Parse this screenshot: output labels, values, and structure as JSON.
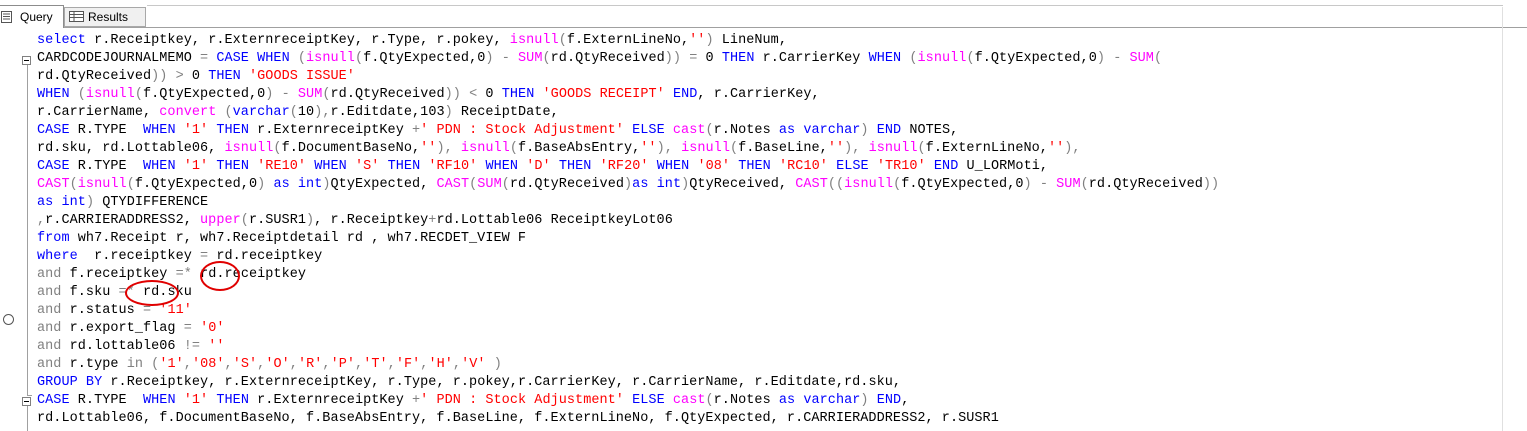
{
  "tabs": [
    {
      "label": "Query",
      "icon": "query-document-icon",
      "active": true
    },
    {
      "label": "Results",
      "icon": "results-grid-icon",
      "active": false
    }
  ],
  "code": [
    [
      [
        "k",
        "select"
      ],
      [
        "t",
        " r.Receiptkey, r.ExternreceiptKey, r.Type, r.pokey, "
      ],
      [
        "f",
        "isnull"
      ],
      [
        "g",
        "("
      ],
      [
        "t",
        "f.ExternLineNo,"
      ],
      [
        "s",
        "''"
      ],
      [
        "g",
        ")"
      ],
      [
        "t",
        " LineNum,"
      ]
    ],
    [
      [
        "t",
        "CARDCODEJOURNALMEMO "
      ],
      [
        "g",
        "="
      ],
      [
        "t",
        " "
      ],
      [
        "k",
        "CASE"
      ],
      [
        "t",
        " "
      ],
      [
        "k",
        "WHEN"
      ],
      [
        "t",
        " "
      ],
      [
        "g",
        "("
      ],
      [
        "f",
        "isnull"
      ],
      [
        "g",
        "("
      ],
      [
        "t",
        "f.QtyExpected,0"
      ],
      [
        "g",
        ")"
      ],
      [
        "t",
        " "
      ],
      [
        "g",
        "-"
      ],
      [
        "t",
        " "
      ],
      [
        "f",
        "SUM"
      ],
      [
        "g",
        "("
      ],
      [
        "t",
        "rd.QtyReceived"
      ],
      [
        "g",
        "))"
      ],
      [
        "t",
        " "
      ],
      [
        "g",
        "="
      ],
      [
        "t",
        " 0 "
      ],
      [
        "k",
        "THEN"
      ],
      [
        "t",
        " r.CarrierKey "
      ],
      [
        "k",
        "WHEN"
      ],
      [
        "t",
        " "
      ],
      [
        "g",
        "("
      ],
      [
        "f",
        "isnull"
      ],
      [
        "g",
        "("
      ],
      [
        "t",
        "f.QtyExpected,0"
      ],
      [
        "g",
        ")"
      ],
      [
        "t",
        " "
      ],
      [
        "g",
        "-"
      ],
      [
        "t",
        " "
      ],
      [
        "f",
        "SUM"
      ],
      [
        "g",
        "("
      ]
    ],
    [
      [
        "t",
        "rd.QtyReceived"
      ],
      [
        "g",
        "))"
      ],
      [
        "t",
        " "
      ],
      [
        "g",
        ">"
      ],
      [
        "t",
        " 0 "
      ],
      [
        "k",
        "THEN"
      ],
      [
        "t",
        " "
      ],
      [
        "s",
        "'GOODS ISSUE'"
      ]
    ],
    [
      [
        "k",
        "WHEN"
      ],
      [
        "t",
        " "
      ],
      [
        "g",
        "("
      ],
      [
        "f",
        "isnull"
      ],
      [
        "g",
        "("
      ],
      [
        "t",
        "f.QtyExpected,0"
      ],
      [
        "g",
        ")"
      ],
      [
        "t",
        " "
      ],
      [
        "g",
        "-"
      ],
      [
        "t",
        " "
      ],
      [
        "f",
        "SUM"
      ],
      [
        "g",
        "("
      ],
      [
        "t",
        "rd.QtyReceived"
      ],
      [
        "g",
        "))"
      ],
      [
        "t",
        " "
      ],
      [
        "g",
        "<"
      ],
      [
        "t",
        " 0 "
      ],
      [
        "k",
        "THEN"
      ],
      [
        "t",
        " "
      ],
      [
        "s",
        "'GOODS RECEIPT'"
      ],
      [
        "t",
        " "
      ],
      [
        "k",
        "END"
      ],
      [
        "t",
        ", r.CarrierKey,"
      ]
    ],
    [
      [
        "t",
        "r.CarrierName, "
      ],
      [
        "f",
        "convert"
      ],
      [
        "t",
        " "
      ],
      [
        "g",
        "("
      ],
      [
        "k",
        "varchar"
      ],
      [
        "g",
        "("
      ],
      [
        "t",
        "10"
      ],
      [
        "g",
        "),"
      ],
      [
        "t",
        "r.Editdate,103"
      ],
      [
        "g",
        ")"
      ],
      [
        "t",
        " ReceiptDate,"
      ]
    ],
    [
      [
        "k",
        "CASE"
      ],
      [
        "t",
        " R.TYPE  "
      ],
      [
        "k",
        "WHEN"
      ],
      [
        "t",
        " "
      ],
      [
        "s",
        "'1'"
      ],
      [
        "t",
        " "
      ],
      [
        "k",
        "THEN"
      ],
      [
        "t",
        " r.ExternreceiptKey "
      ],
      [
        "g",
        "+"
      ],
      [
        "s",
        "' PDN : Stock Adjustment'"
      ],
      [
        "t",
        " "
      ],
      [
        "k",
        "ELSE"
      ],
      [
        "t",
        " "
      ],
      [
        "f",
        "cast"
      ],
      [
        "g",
        "("
      ],
      [
        "t",
        "r.Notes "
      ],
      [
        "k",
        "as"
      ],
      [
        "t",
        " "
      ],
      [
        "k",
        "varchar"
      ],
      [
        "g",
        ")"
      ],
      [
        "t",
        " "
      ],
      [
        "k",
        "END"
      ],
      [
        "t",
        " NOTES,"
      ]
    ],
    [
      [
        "t",
        "rd.sku, rd.Lottable06, "
      ],
      [
        "f",
        "isnull"
      ],
      [
        "g",
        "("
      ],
      [
        "t",
        "f.DocumentBaseNo,"
      ],
      [
        "s",
        "''"
      ],
      [
        "g",
        "),"
      ],
      [
        "t",
        " "
      ],
      [
        "f",
        "isnull"
      ],
      [
        "g",
        "("
      ],
      [
        "t",
        "f.BaseAbsEntry,"
      ],
      [
        "s",
        "''"
      ],
      [
        "g",
        "),"
      ],
      [
        "t",
        " "
      ],
      [
        "f",
        "isnull"
      ],
      [
        "g",
        "("
      ],
      [
        "t",
        "f.BaseLine,"
      ],
      [
        "s",
        "''"
      ],
      [
        "g",
        "),"
      ],
      [
        "t",
        " "
      ],
      [
        "f",
        "isnull"
      ],
      [
        "g",
        "("
      ],
      [
        "t",
        "f.ExternLineNo,"
      ],
      [
        "s",
        "''"
      ],
      [
        "g",
        "),"
      ]
    ],
    [
      [
        "k",
        "CASE"
      ],
      [
        "t",
        " R.TYPE  "
      ],
      [
        "k",
        "WHEN"
      ],
      [
        "t",
        " "
      ],
      [
        "s",
        "'1'"
      ],
      [
        "t",
        " "
      ],
      [
        "k",
        "THEN"
      ],
      [
        "t",
        " "
      ],
      [
        "s",
        "'RE10'"
      ],
      [
        "t",
        " "
      ],
      [
        "k",
        "WHEN"
      ],
      [
        "t",
        " "
      ],
      [
        "s",
        "'S'"
      ],
      [
        "t",
        " "
      ],
      [
        "k",
        "THEN"
      ],
      [
        "t",
        " "
      ],
      [
        "s",
        "'RF10'"
      ],
      [
        "t",
        " "
      ],
      [
        "k",
        "WHEN"
      ],
      [
        "t",
        " "
      ],
      [
        "s",
        "'D'"
      ],
      [
        "t",
        " "
      ],
      [
        "k",
        "THEN"
      ],
      [
        "t",
        " "
      ],
      [
        "s",
        "'RF20'"
      ],
      [
        "t",
        " "
      ],
      [
        "k",
        "WHEN"
      ],
      [
        "t",
        " "
      ],
      [
        "s",
        "'08'"
      ],
      [
        "t",
        " "
      ],
      [
        "k",
        "THEN"
      ],
      [
        "t",
        " "
      ],
      [
        "s",
        "'RC10'"
      ],
      [
        "t",
        " "
      ],
      [
        "k",
        "ELSE"
      ],
      [
        "t",
        " "
      ],
      [
        "s",
        "'TR10'"
      ],
      [
        "t",
        " "
      ],
      [
        "k",
        "END"
      ],
      [
        "t",
        " U_LORMoti,"
      ]
    ],
    [
      [
        "f",
        "CAST"
      ],
      [
        "g",
        "("
      ],
      [
        "f",
        "isnull"
      ],
      [
        "g",
        "("
      ],
      [
        "t",
        "f.QtyExpected,0"
      ],
      [
        "g",
        ")"
      ],
      [
        "t",
        " "
      ],
      [
        "k",
        "as"
      ],
      [
        "t",
        " "
      ],
      [
        "k",
        "int"
      ],
      [
        "g",
        ")"
      ],
      [
        "t",
        "QtyExpected, "
      ],
      [
        "f",
        "CAST"
      ],
      [
        "g",
        "("
      ],
      [
        "f",
        "SUM"
      ],
      [
        "g",
        "("
      ],
      [
        "t",
        "rd.QtyReceived"
      ],
      [
        "g",
        ")"
      ],
      [
        "k",
        "as"
      ],
      [
        "t",
        " "
      ],
      [
        "k",
        "int"
      ],
      [
        "g",
        ")"
      ],
      [
        "t",
        "QtyReceived, "
      ],
      [
        "f",
        "CAST"
      ],
      [
        "g",
        "(("
      ],
      [
        "f",
        "isnull"
      ],
      [
        "g",
        "("
      ],
      [
        "t",
        "f.QtyExpected,0"
      ],
      [
        "g",
        ")"
      ],
      [
        "t",
        " "
      ],
      [
        "g",
        "-"
      ],
      [
        "t",
        " "
      ],
      [
        "f",
        "SUM"
      ],
      [
        "g",
        "("
      ],
      [
        "t",
        "rd.QtyReceived"
      ],
      [
        "g",
        "))"
      ]
    ],
    [
      [
        "k",
        "as"
      ],
      [
        "t",
        " "
      ],
      [
        "k",
        "int"
      ],
      [
        "g",
        ")"
      ],
      [
        "t",
        " QTYDIFFERENCE"
      ]
    ],
    [
      [
        "g",
        ","
      ],
      [
        "t",
        "r.CARRIERADDRESS2, "
      ],
      [
        "f",
        "upper"
      ],
      [
        "g",
        "("
      ],
      [
        "t",
        "r.SUSR1"
      ],
      [
        "g",
        ")"
      ],
      [
        "t",
        ", r.Receiptkey"
      ],
      [
        "g",
        "+"
      ],
      [
        "t",
        "rd.Lottable06 ReceiptkeyLot06"
      ]
    ],
    [
      [
        "k",
        "from"
      ],
      [
        "t",
        " wh7.Receipt r, wh7.Receiptdetail rd , wh7.RECDET_VIEW F"
      ]
    ],
    [
      [
        "k",
        "where"
      ],
      [
        "t",
        "  r.receiptkey "
      ],
      [
        "g",
        "="
      ],
      [
        "t",
        " rd.receiptkey"
      ]
    ],
    [
      [
        "g",
        "and"
      ],
      [
        "t",
        " f.receiptkey "
      ],
      [
        "g",
        "=*"
      ],
      [
        "t",
        " rd.receiptkey"
      ]
    ],
    [
      [
        "g",
        "and"
      ],
      [
        "t",
        " f.sku "
      ],
      [
        "g",
        "=*"
      ],
      [
        "t",
        " rd.sku"
      ]
    ],
    [
      [
        "g",
        "and"
      ],
      [
        "t",
        " r.status "
      ],
      [
        "g",
        "="
      ],
      [
        "t",
        " "
      ],
      [
        "s",
        "'11'"
      ]
    ],
    [
      [
        "g",
        "and"
      ],
      [
        "t",
        " r.export_flag "
      ],
      [
        "g",
        "="
      ],
      [
        "t",
        " "
      ],
      [
        "s",
        "'0'"
      ]
    ],
    [
      [
        "g",
        "and"
      ],
      [
        "t",
        " rd.lottable06 "
      ],
      [
        "g",
        "!="
      ],
      [
        "t",
        " "
      ],
      [
        "s",
        "''"
      ]
    ],
    [
      [
        "g",
        "and"
      ],
      [
        "t",
        " r.type "
      ],
      [
        "g",
        "in"
      ],
      [
        "t",
        " "
      ],
      [
        "g",
        "("
      ],
      [
        "s",
        "'1'"
      ],
      [
        "g",
        ","
      ],
      [
        "s",
        "'08'"
      ],
      [
        "g",
        ","
      ],
      [
        "s",
        "'S'"
      ],
      [
        "g",
        ","
      ],
      [
        "s",
        "'O'"
      ],
      [
        "g",
        ","
      ],
      [
        "s",
        "'R'"
      ],
      [
        "g",
        ","
      ],
      [
        "s",
        "'P'"
      ],
      [
        "g",
        ","
      ],
      [
        "s",
        "'T'"
      ],
      [
        "g",
        ","
      ],
      [
        "s",
        "'F'"
      ],
      [
        "g",
        ","
      ],
      [
        "s",
        "'H'"
      ],
      [
        "g",
        ","
      ],
      [
        "s",
        "'V'"
      ],
      [
        "t",
        " "
      ],
      [
        "g",
        ")"
      ]
    ],
    [
      [
        "k",
        "GROUP"
      ],
      [
        "t",
        " "
      ],
      [
        "k",
        "BY"
      ],
      [
        "t",
        " r.Receiptkey, r.ExternreceiptKey, r.Type, r.pokey,r.CarrierKey, r.CarrierName, r.Editdate,rd.sku,"
      ]
    ],
    [
      [
        "k",
        "CASE"
      ],
      [
        "t",
        " R.TYPE  "
      ],
      [
        "k",
        "WHEN"
      ],
      [
        "t",
        " "
      ],
      [
        "s",
        "'1'"
      ],
      [
        "t",
        " "
      ],
      [
        "k",
        "THEN"
      ],
      [
        "t",
        " r.ExternreceiptKey "
      ],
      [
        "g",
        "+"
      ],
      [
        "s",
        "' PDN : Stock Adjustment'"
      ],
      [
        "t",
        " "
      ],
      [
        "k",
        "ELSE"
      ],
      [
        "t",
        " "
      ],
      [
        "f",
        "cast"
      ],
      [
        "g",
        "("
      ],
      [
        "t",
        "r.Notes "
      ],
      [
        "k",
        "as"
      ],
      [
        "t",
        " "
      ],
      [
        "k",
        "varchar"
      ],
      [
        "g",
        ")"
      ],
      [
        "t",
        " "
      ],
      [
        "k",
        "END"
      ],
      [
        "t",
        ","
      ]
    ],
    [
      [
        "t",
        "rd.Lottable06, f.DocumentBaseNo, f.BaseAbsEntry, f.BaseLine, f.ExternLineNo, f.QtyExpected, r.CARRIERADDRESS2, r.SUSR1"
      ]
    ]
  ]
}
